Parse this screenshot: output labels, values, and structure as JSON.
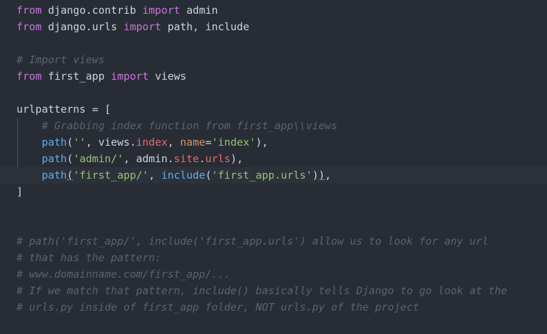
{
  "editor": {
    "lines": [
      {
        "kind": "code",
        "tokens": [
          [
            "kw",
            "from"
          ],
          [
            "pl",
            " django.contrib "
          ],
          [
            "kw",
            "import"
          ],
          [
            "pl",
            " admin"
          ]
        ]
      },
      {
        "kind": "code",
        "tokens": [
          [
            "kw",
            "from"
          ],
          [
            "pl",
            " django.urls "
          ],
          [
            "kw",
            "import"
          ],
          [
            "pl",
            " path, include"
          ]
        ]
      },
      {
        "kind": "blank",
        "tokens": []
      },
      {
        "kind": "code",
        "tokens": [
          [
            "cm",
            "# Import views"
          ]
        ]
      },
      {
        "kind": "code",
        "tokens": [
          [
            "kw",
            "from"
          ],
          [
            "pl",
            " first_app "
          ],
          [
            "kw",
            "import"
          ],
          [
            "pl",
            " views"
          ]
        ]
      },
      {
        "kind": "blank",
        "tokens": []
      },
      {
        "kind": "code",
        "tokens": [
          [
            "pl",
            "urlpatterns = ["
          ]
        ]
      },
      {
        "kind": "code",
        "tokens": [
          [
            "pl",
            "    "
          ],
          [
            "cm",
            "# Grabbing index function from first_app\\\\views"
          ]
        ]
      },
      {
        "kind": "code",
        "tokens": [
          [
            "pl",
            "    "
          ],
          [
            "fn",
            "path"
          ],
          [
            "pl",
            "("
          ],
          [
            "str",
            "''"
          ],
          [
            "pl",
            ", views."
          ],
          [
            "var",
            "index"
          ],
          [
            "pl",
            ", "
          ],
          [
            "param",
            "name"
          ],
          [
            "pl",
            "="
          ],
          [
            "str",
            "'index'"
          ],
          [
            "pl",
            "),"
          ]
        ]
      },
      {
        "kind": "code",
        "tokens": [
          [
            "pl",
            "    "
          ],
          [
            "fn",
            "path"
          ],
          [
            "pl",
            "("
          ],
          [
            "str",
            "'admin/'"
          ],
          [
            "pl",
            ", admin."
          ],
          [
            "var",
            "site"
          ],
          [
            "pl",
            "."
          ],
          [
            "var",
            "urls"
          ],
          [
            "pl",
            "),"
          ]
        ]
      },
      {
        "kind": "current",
        "tokens": [
          [
            "pl",
            "    "
          ],
          [
            "fn",
            "path"
          ],
          [
            "pl bracket-match",
            "("
          ],
          [
            "str",
            "'first_app/'"
          ],
          [
            "pl",
            ", "
          ],
          [
            "fn",
            "include"
          ],
          [
            "pl",
            "("
          ],
          [
            "str",
            "'first_app.urls'"
          ],
          [
            "pl",
            ")"
          ],
          [
            "pl bracket-match",
            ")"
          ],
          [
            "pl",
            ","
          ]
        ]
      },
      {
        "kind": "code",
        "tokens": [
          [
            "pl",
            "]"
          ]
        ]
      },
      {
        "kind": "blank",
        "tokens": []
      },
      {
        "kind": "blank",
        "tokens": []
      },
      {
        "kind": "code",
        "tokens": [
          [
            "cm",
            "# path('first_app/', include('first_app.urls') allow us to look for any url"
          ]
        ]
      },
      {
        "kind": "code",
        "tokens": [
          [
            "cm",
            "# that has the pattern:"
          ]
        ]
      },
      {
        "kind": "code",
        "tokens": [
          [
            "cm",
            "# www.domainname.com/first_app/..."
          ]
        ]
      },
      {
        "kind": "code",
        "tokens": [
          [
            "cm",
            "# If we match that pattern, include() basically tells Django to go look at the"
          ]
        ]
      },
      {
        "kind": "code",
        "tokens": [
          [
            "cm",
            "# urls.py inside of first_app folder, NOT urls.py of the project"
          ]
        ]
      }
    ]
  }
}
